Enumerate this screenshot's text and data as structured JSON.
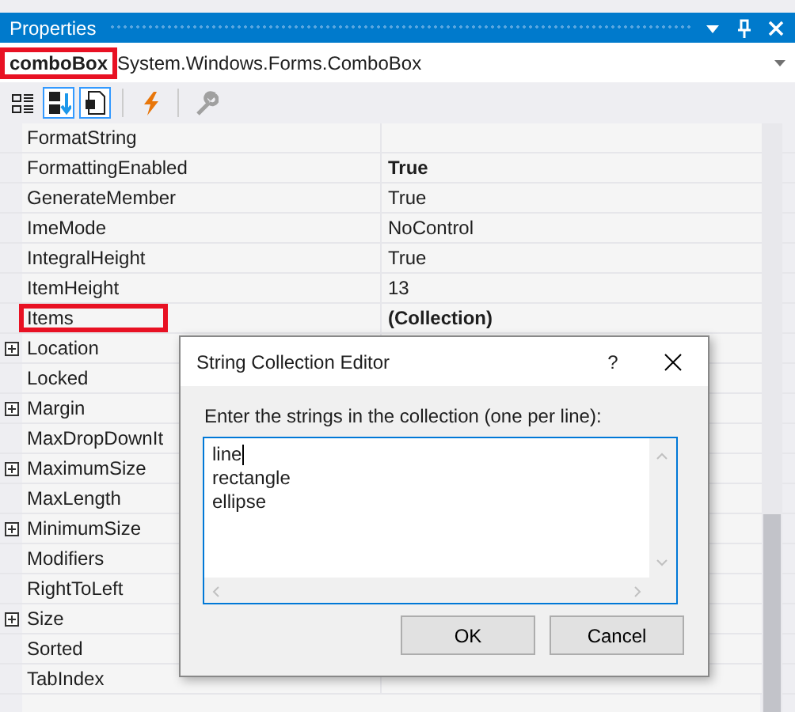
{
  "window": {
    "title": "Properties"
  },
  "selector": {
    "name": "comboBox",
    "name_highlighted": true,
    "type": "System.Windows.Forms.ComboBox"
  },
  "toolbar": [
    {
      "kind": "categorized",
      "selected": false
    },
    {
      "kind": "alphabetical",
      "selected": true
    },
    {
      "kind": "pages",
      "selected": true
    },
    {
      "kind": "events",
      "selected": false
    },
    {
      "kind": "wrench",
      "selected": false
    }
  ],
  "properties": [
    {
      "name": "FormatString",
      "expandable": false,
      "highlighted": false
    },
    {
      "name": "FormattingEnabled",
      "value": "True",
      "bold": true,
      "expandable": false,
      "highlighted": false
    },
    {
      "name": "GenerateMember",
      "value": "True",
      "bold": false,
      "expandable": false,
      "highlighted": false
    },
    {
      "name": "ImeMode",
      "value": "NoControl",
      "bold": false,
      "expandable": false,
      "highlighted": false
    },
    {
      "name": "IntegralHeight",
      "value": "True",
      "bold": false,
      "expandable": false,
      "highlighted": false
    },
    {
      "name": "ItemHeight",
      "value": "13",
      "bold": false,
      "expandable": false,
      "highlighted": false
    },
    {
      "name": "Items",
      "value": "(Collection)",
      "bold": true,
      "expandable": false,
      "highlighted": true
    },
    {
      "name": "Location",
      "expandable": true,
      "highlighted": false
    },
    {
      "name": "Locked",
      "expandable": false,
      "highlighted": false
    },
    {
      "name": "Margin",
      "expandable": true,
      "highlighted": false
    },
    {
      "name": "MaxDropDownIt",
      "expandable": false,
      "highlighted": false
    },
    {
      "name": "MaximumSize",
      "expandable": true,
      "highlighted": false
    },
    {
      "name": "MaxLength",
      "expandable": false,
      "highlighted": false
    },
    {
      "name": "MinimumSize",
      "expandable": true,
      "highlighted": false
    },
    {
      "name": "Modifiers",
      "expandable": false,
      "highlighted": false
    },
    {
      "name": "RightToLeft",
      "expandable": false,
      "highlighted": false
    },
    {
      "name": "Size",
      "expandable": true,
      "highlighted": false
    },
    {
      "name": "Sorted",
      "expandable": false,
      "highlighted": false
    },
    {
      "name": "TabIndex",
      "expandable": false,
      "highlighted": false
    }
  ],
  "dialog": {
    "title": "String Collection Editor",
    "help": "?",
    "prompt": "Enter the strings in the collection (one per line):",
    "lines": [
      "line",
      "rectangle",
      "ellipse"
    ],
    "buttons": [
      "OK",
      "Cancel"
    ]
  }
}
